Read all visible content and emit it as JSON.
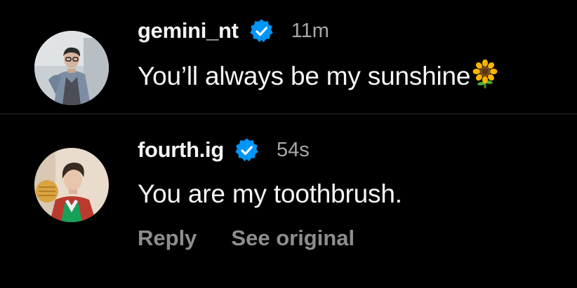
{
  "colors": {
    "background": "#000000",
    "text": "#f5f5f5",
    "muted": "#a8a8a8",
    "action": "#8e8e8e",
    "verified": "#0095f6",
    "divider": "#262626"
  },
  "comments": [
    {
      "username": "gemini_nt",
      "verified": true,
      "verified_icon": "verified-badge-icon",
      "time": "11m",
      "text": "You’ll always be my sunshine",
      "emoji": "sunflower",
      "avatar": "profile-photo"
    },
    {
      "username": "fourth.ig",
      "verified": true,
      "verified_icon": "verified-badge-icon",
      "time": "54s",
      "text": "You are my toothbrush.",
      "avatar": "profile-photo",
      "actions": {
        "reply": "Reply",
        "see_original": "See original"
      }
    }
  ]
}
